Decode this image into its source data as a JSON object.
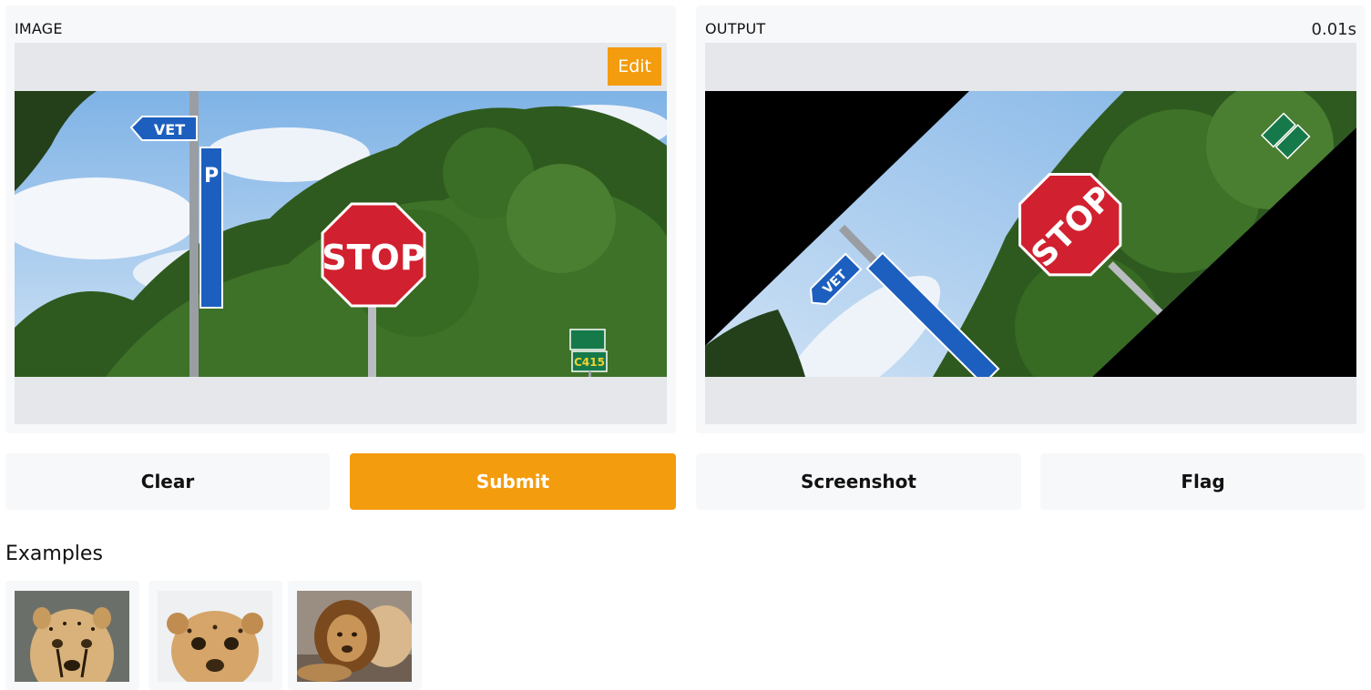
{
  "input_panel": {
    "label": "IMAGE",
    "edit_label": "Edit"
  },
  "output_panel": {
    "label": "OUTPUT",
    "timer": "0.01s"
  },
  "image": {
    "sign_stop": "STOP",
    "sign_vet": "VET",
    "sign_parking": "P",
    "sign_code": "C415"
  },
  "buttons": {
    "clear": "Clear",
    "submit": "Submit",
    "screenshot": "Screenshot",
    "flag": "Flag"
  },
  "examples": {
    "title": "Examples",
    "items": [
      {
        "icon": "cheetah-photo"
      },
      {
        "icon": "cheetah-cub-photo"
      },
      {
        "icon": "lion-photo"
      }
    ]
  },
  "colors": {
    "accent": "#f39c0e",
    "panel_bg": "#f7f8fa",
    "image_frame": "#e5e7eb"
  }
}
